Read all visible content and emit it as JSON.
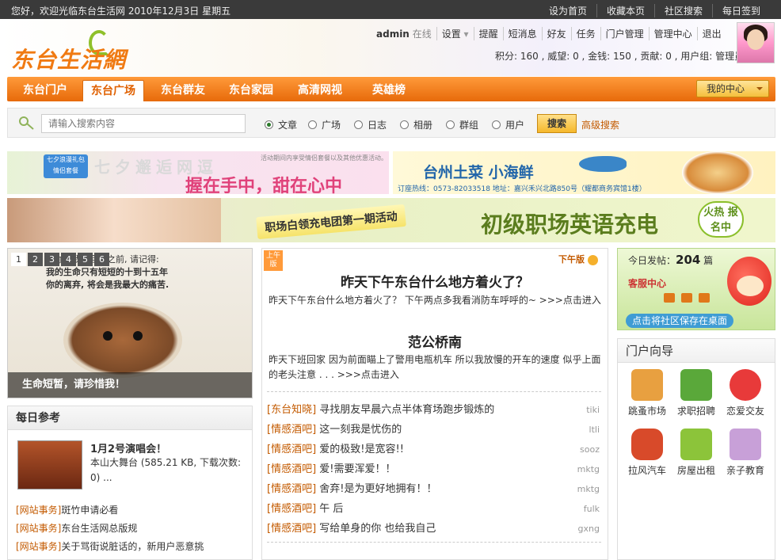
{
  "topbar": {
    "welcome": "您好，欢迎光临东台生活网 2010年12月3日 星期五",
    "links": [
      "设为首页",
      "收藏本页",
      "社区搜索",
      "每日签到"
    ]
  },
  "header": {
    "logo": "东台生活網",
    "user": "admin",
    "status": "在线",
    "menu": [
      "设置",
      "提醒",
      "短消息",
      "好友",
      "任务",
      "门户管理",
      "管理中心",
      "退出"
    ],
    "stats": "积分: 160 , 威望: 0 , 金钱: 150 , 贡献: 0 , 用户组: 管理员"
  },
  "nav": {
    "tabs": [
      "东台门户",
      "东台广场",
      "东台群友",
      "东台家园",
      "高清网视",
      "英雄榜"
    ],
    "active": 1,
    "my_center": "我的中心"
  },
  "search": {
    "placeholder": "请输入搜索内容",
    "options": [
      "文章",
      "广场",
      "日志",
      "相册",
      "群组",
      "用户"
    ],
    "selected": 0,
    "button": "搜索",
    "advanced": "高级搜索"
  },
  "banners": {
    "b1_badge": "七夕浪漫礼包 情侣套餐",
    "b1_title": "七夕邂逅网逗",
    "b1_slogan": "握在手中，甜在心中",
    "b1_note": "活动期间内享受情侣套餐以及其他优惠活动。",
    "b2_title": "台州土菜 小海鲜",
    "b2_phone": "订座热线：0573-82033518  地址：嘉兴禾兴北路850号（耀都商务宾馆1楼）",
    "b3_tag": "职场白领充电团第一期活动",
    "b3_title": "初级职场英语充电",
    "b3_hot": "火热 报名中"
  },
  "slider": {
    "pages": [
      "1",
      "2",
      "3",
      "4",
      "5",
      "6"
    ],
    "active": 0,
    "poem_lines": [
      "在你相我带回家之前, 请记得:",
      "我的生命只有短短的十到十五年",
      "你的离弃, 将会是我最大的痛苦."
    ],
    "caption": "生命短暂，请珍惜我！"
  },
  "daily": {
    "title": "每日参考",
    "item_title": "1月2号演唱会！",
    "item_desc": "本山大舞台 (585.21 KB, 下载次数: 0) ...",
    "list": [
      {
        "cat": "[网站事务]",
        "text": "斑竹申请必看"
      },
      {
        "cat": "[网站事务]",
        "text": "东台生活网总版规"
      },
      {
        "cat": "[网站事务]",
        "text": "关于骂街说脏话的，新用户恶意挑"
      }
    ]
  },
  "news": {
    "am_label": "上午版",
    "pm_label": "下午版",
    "headline1": "昨天下午东台什么地方着火了？",
    "summary1": "昨天下午东台什么地方着火了？ 下午两点多我看消防车呼呼的~ >>>点击进入",
    "headline2": "范公桥南",
    "summary2": "昨天下班回家 因为前面瞄上了警用电瓶机车 所以我放慢的开车的速度 似乎上面的老头注意 . . . >>>点击进入",
    "rows": [
      {
        "cat": "[东台知晓]",
        "title": "寻找朋友早晨六点半体育场跑步锻炼的",
        "user": "tiki"
      },
      {
        "cat": "[情感酒吧]",
        "title": "这一刻我是忧伤的",
        "user": "ltli"
      },
      {
        "cat": "[情感酒吧]",
        "title": "爱的极致!是宽容!!",
        "user": "sooz"
      },
      {
        "cat": "[情感酒吧]",
        "title": "爱!需要浑爱！！",
        "user": "mktg"
      },
      {
        "cat": "[情感酒吧]",
        "title": "舍弃!是为更好地拥有！！",
        "user": "mktg"
      },
      {
        "cat": "[情感酒吧]",
        "title": "午 后",
        "user": "fulk"
      },
      {
        "cat": "[情感酒吧]",
        "title": "写给单身的你 也给我自己",
        "user": "gxng"
      }
    ]
  },
  "today": {
    "label": "今日发帖：",
    "count": "204",
    "unit": "篇",
    "service": "客服中心",
    "save": "点击将社区保存在桌面"
  },
  "portal": {
    "title": "门户向导",
    "items": [
      {
        "label": "跳蚤市场",
        "icon": "house-icon",
        "color": "#e8a040"
      },
      {
        "label": "求职招聘",
        "icon": "books-icon",
        "color": "#5aa83a"
      },
      {
        "label": "恋爱交友",
        "icon": "hearts-icon",
        "color": "#e83a3a"
      },
      {
        "label": "拉风汽车",
        "icon": "car-icon",
        "color": "#d84a2a"
      },
      {
        "label": "房屋出租",
        "icon": "house-key-icon",
        "color": "#8cc43a"
      },
      {
        "label": "亲子教育",
        "icon": "family-icon",
        "color": "#c8a0d8"
      }
    ]
  }
}
